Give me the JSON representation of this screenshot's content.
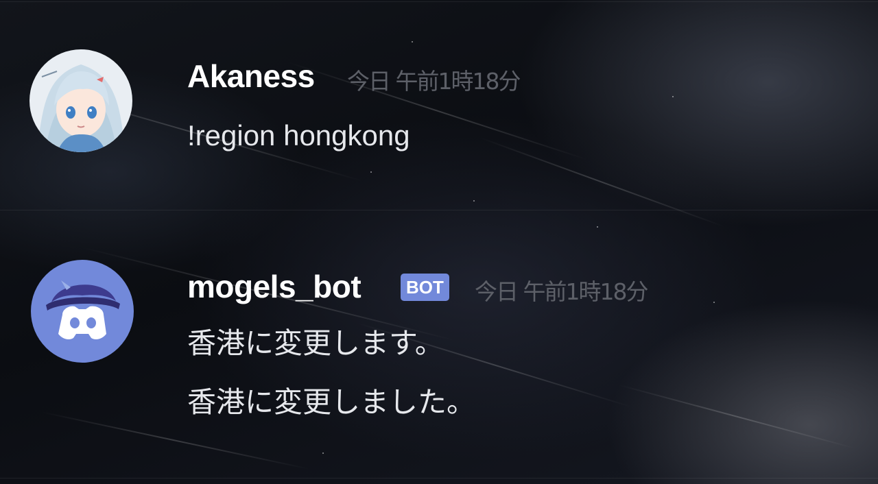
{
  "colors": {
    "background": "#0e1015",
    "username": "#ffffff",
    "timestamp": "#5d6068",
    "message_text": "#e6e8ec",
    "bot_tag_bg": "#7289da",
    "bot_avatar_bg": "#7289da"
  },
  "messages": [
    {
      "author": "Akaness",
      "avatar_icon": "anime-girl-avatar-icon",
      "timestamp": "今日 午前1時18分",
      "lines": [
        "!region hongkong"
      ]
    },
    {
      "author": "mogels_bot",
      "avatar_icon": "discord-bot-avatar-icon",
      "tag": "BOT",
      "timestamp": "今日 午前1時18分",
      "lines": [
        "香港に変更します。",
        "香港に変更しました。"
      ]
    }
  ]
}
